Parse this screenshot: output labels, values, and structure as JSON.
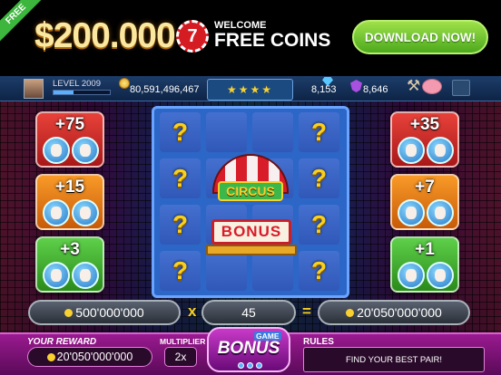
{
  "banner": {
    "ribbon": "FREE",
    "amount": "$200.000",
    "chip_symbol": "7",
    "welcome": "WELCOME",
    "free_coins": "FREE COINS",
    "download_label": "DOWNLOAD NOW!"
  },
  "status": {
    "level": "LEVEL 2009",
    "xp_progress": 0.35,
    "coins": "80,591,496,467",
    "stars": "★★★★",
    "gems": "8,153",
    "shields": "8,646"
  },
  "prizes": {
    "left": [
      "+75",
      "+15",
      "+3"
    ],
    "right": [
      "+35",
      "+7",
      "+1"
    ]
  },
  "board": {
    "question_mark": "?",
    "sign_text": "CIRCUS",
    "reel_text": "BONUS"
  },
  "calc": {
    "bet": "500'000'000",
    "times": "x",
    "multiplier": "45",
    "equals": "=",
    "result": "20'050'000'000"
  },
  "bottom": {
    "reward_title": "YOUR REWARD",
    "reward_value": "20'050'000'000",
    "multiplier_title": "MULTIPLIER",
    "multiplier_value": "2x",
    "game_label": "GAME",
    "bonus_label": "BONUS",
    "rules_title": "RULES",
    "rules_text": "FIND YOUR BEST PAIR!"
  },
  "colors": {
    "download_button": "#5cba2a",
    "bottom_bar": "#8a1a88",
    "board": "#2c66c6"
  }
}
